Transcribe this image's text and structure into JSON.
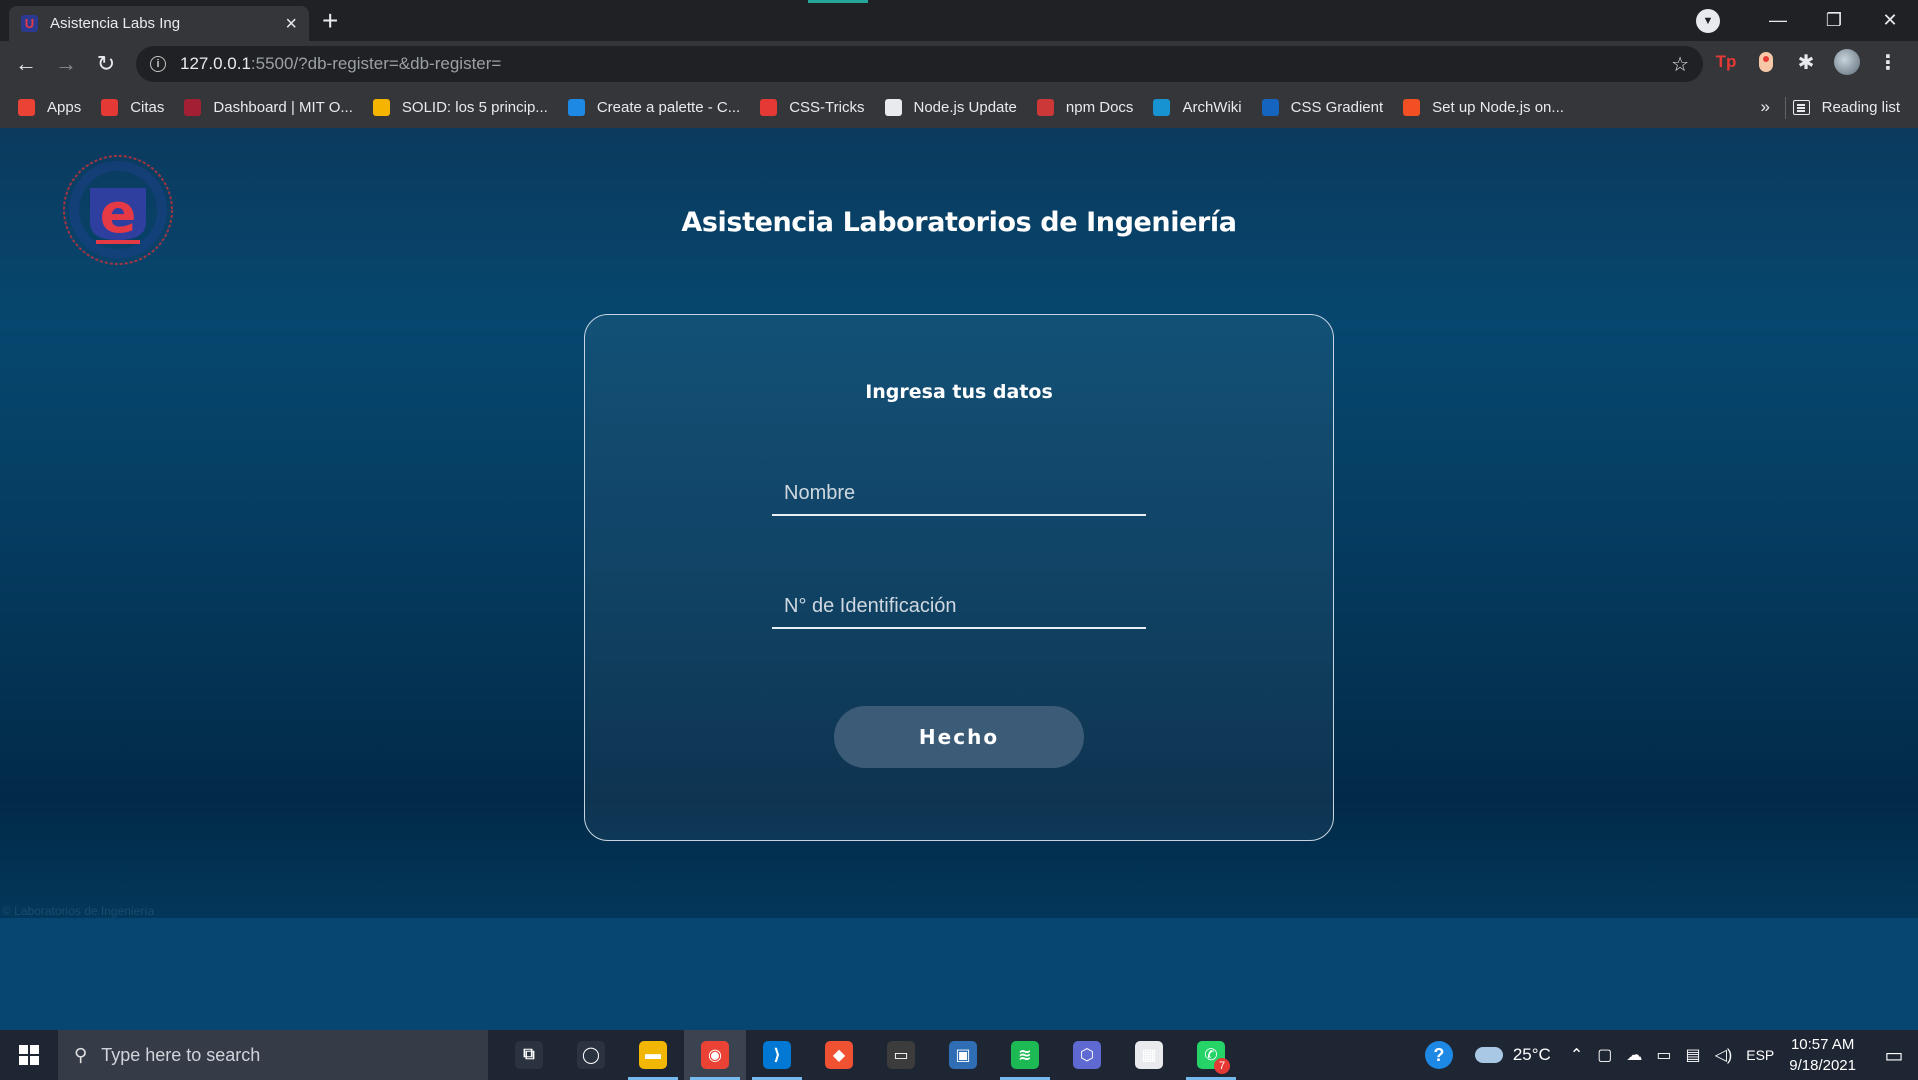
{
  "browser": {
    "tab_title": "Asistencia Labs Ing",
    "tab_favicon_letter": "U",
    "url_host": "127.0.0.1",
    "url_rest": ":5500/?db-register=&db-register=",
    "bookmarks": [
      {
        "label": "Apps",
        "icon": "apps-grid-icon",
        "color": "#ea4335"
      },
      {
        "label": "Citas",
        "icon": "book-icon",
        "color": "#e53935"
      },
      {
        "label": "Dashboard | MIT O...",
        "icon": "mit-icon",
        "color": "#a31f34"
      },
      {
        "label": "SOLID: los 5 princip...",
        "icon": "solid-icon",
        "color": "#f4b400"
      },
      {
        "label": "Create a palette - C...",
        "icon": "coolors-icon",
        "color": "#1e88e5"
      },
      {
        "label": "CSS-Tricks",
        "icon": "css-tricks-icon",
        "color": "#e53935"
      },
      {
        "label": "Node.js Update",
        "icon": "wordpress-icon",
        "color": "#e8eaed"
      },
      {
        "label": "npm Docs",
        "icon": "npm-icon",
        "color": "#cb3837"
      },
      {
        "label": "ArchWiki",
        "icon": "arch-icon",
        "color": "#1793d1"
      },
      {
        "label": "CSS Gradient",
        "icon": "gradient-icon",
        "color": "#1565c0"
      },
      {
        "label": "Set up Node.js on...",
        "icon": "microsoft-icon",
        "color": "#f25022"
      }
    ],
    "more_label": "»",
    "reading_list_label": "Reading list"
  },
  "page": {
    "site_title": "Asistencia Laboratorios de Ingeniería",
    "logo_letter": "e",
    "card_title": "Ingresa tus datos",
    "name_placeholder": "Nombre",
    "id_placeholder": "N° de Identificación",
    "submit_label": "Hecho",
    "footer_text": "© Laboratorios de Ingeniería",
    "colors": {
      "accent_button": "#3b5b77",
      "background_top": "#06476f",
      "background_bottom": "#022a48"
    }
  },
  "taskbar": {
    "search_placeholder": "Type here to search",
    "apps": [
      {
        "name": "task-view-icon",
        "glyph": "⧉",
        "color": "#2b3240",
        "running": false,
        "active": false
      },
      {
        "name": "cortana-icon",
        "glyph": "◯",
        "color": "#2b3240",
        "running": false,
        "active": false
      },
      {
        "name": "file-explorer-icon",
        "glyph": "▬",
        "color": "#f2b705",
        "running": true,
        "active": false
      },
      {
        "name": "chrome-icon",
        "glyph": "◉",
        "color": "#ea4335",
        "running": true,
        "active": true
      },
      {
        "name": "vscode-icon",
        "glyph": "⟩",
        "color": "#0078d4",
        "running": true,
        "active": false
      },
      {
        "name": "git-icon",
        "glyph": "◆",
        "color": "#f05133",
        "running": false,
        "active": false
      },
      {
        "name": "terminal-icon",
        "glyph": "▭",
        "color": "#3c3c3c",
        "running": false,
        "active": false
      },
      {
        "name": "virtualbox-icon",
        "glyph": "▣",
        "color": "#2f6db5",
        "running": false,
        "active": false
      },
      {
        "name": "spotify-icon",
        "glyph": "≋",
        "color": "#1db954",
        "running": true,
        "active": false
      },
      {
        "name": "app-hexagon-icon",
        "glyph": "⬡",
        "color": "#5e6ad2",
        "running": false,
        "active": false
      },
      {
        "name": "store-icon",
        "glyph": "▦",
        "color": "#e8eaed",
        "running": false,
        "active": false
      },
      {
        "name": "whatsapp-icon",
        "glyph": "✆",
        "color": "#25d366",
        "running": true,
        "active": false,
        "badge": "7"
      }
    ],
    "temperature": "25°C",
    "language": "ESP",
    "time": "10:57 AM",
    "date": "9/18/2021"
  }
}
